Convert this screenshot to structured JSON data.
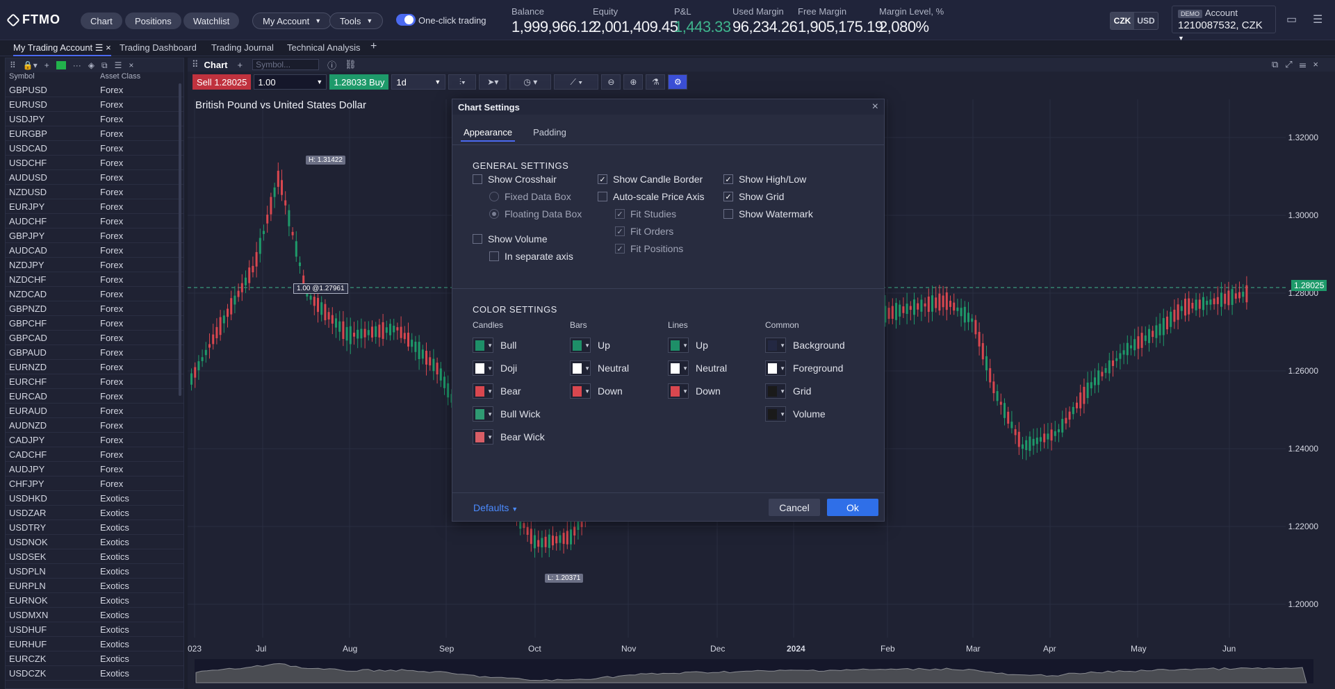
{
  "brand": "FTMO",
  "nav": {
    "chart": "Chart",
    "positions": "Positions",
    "watchlist": "Watchlist",
    "my_account": "My Account",
    "tools": "Tools",
    "one_click": "One-click trading"
  },
  "metrics": {
    "balance_label": "Balance",
    "balance": "1,999,966.12",
    "equity_label": "Equity",
    "equity": "2,001,409.45",
    "pnl_label": "P&L",
    "pnl": "1,443.33",
    "used_margin_label": "Used Margin",
    "used_margin": "96,234.26",
    "free_margin_label": "Free Margin",
    "free_margin": "1,905,175.19",
    "margin_level_label": "Margin Level, %",
    "margin_level": "2,080%"
  },
  "currency": {
    "czk": "CZK",
    "usd": "USD"
  },
  "account": {
    "badge": "DEMO",
    "label": "Account",
    "number": "1210087532, CZK"
  },
  "tabs": {
    "my_trading_account": "My Trading Account",
    "trading_dashboard": "Trading Dashboard",
    "trading_journal": "Trading Journal",
    "technical_analysis": "Technical Analysis"
  },
  "watchlist": {
    "col_symbol": "Symbol",
    "col_class": "Asset Class",
    "rows": [
      [
        "GBPUSD",
        "Forex"
      ],
      [
        "EURUSD",
        "Forex"
      ],
      [
        "USDJPY",
        "Forex"
      ],
      [
        "EURGBP",
        "Forex"
      ],
      [
        "USDCAD",
        "Forex"
      ],
      [
        "USDCHF",
        "Forex"
      ],
      [
        "AUDUSD",
        "Forex"
      ],
      [
        "NZDUSD",
        "Forex"
      ],
      [
        "EURJPY",
        "Forex"
      ],
      [
        "AUDCHF",
        "Forex"
      ],
      [
        "GBPJPY",
        "Forex"
      ],
      [
        "AUDCAD",
        "Forex"
      ],
      [
        "NZDJPY",
        "Forex"
      ],
      [
        "NZDCHF",
        "Forex"
      ],
      [
        "NZDCAD",
        "Forex"
      ],
      [
        "GBPNZD",
        "Forex"
      ],
      [
        "GBPCHF",
        "Forex"
      ],
      [
        "GBPCAD",
        "Forex"
      ],
      [
        "GBPAUD",
        "Forex"
      ],
      [
        "EURNZD",
        "Forex"
      ],
      [
        "EURCHF",
        "Forex"
      ],
      [
        "EURCAD",
        "Forex"
      ],
      [
        "EURAUD",
        "Forex"
      ],
      [
        "AUDNZD",
        "Forex"
      ],
      [
        "CADJPY",
        "Forex"
      ],
      [
        "CADCHF",
        "Forex"
      ],
      [
        "AUDJPY",
        "Forex"
      ],
      [
        "CHFJPY",
        "Forex"
      ],
      [
        "USDHKD",
        "Exotics"
      ],
      [
        "USDZAR",
        "Exotics"
      ],
      [
        "USDTRY",
        "Exotics"
      ],
      [
        "USDNOK",
        "Exotics"
      ],
      [
        "USDSEK",
        "Exotics"
      ],
      [
        "USDPLN",
        "Exotics"
      ],
      [
        "EURPLN",
        "Exotics"
      ],
      [
        "EURNOK",
        "Exotics"
      ],
      [
        "USDMXN",
        "Exotics"
      ],
      [
        "USDHUF",
        "Exotics"
      ],
      [
        "EURHUF",
        "Exotics"
      ],
      [
        "EURCZK",
        "Exotics"
      ],
      [
        "USDCZK",
        "Exotics"
      ]
    ]
  },
  "chart": {
    "tab": "Chart",
    "symbol_placeholder": "Symbol...",
    "sell_label": "Sell",
    "sell_price": "1.28025",
    "quantity": "1.00",
    "buy_label": "Buy",
    "buy_price": "1.28033",
    "timeframe": "1d",
    "title": "British Pound vs United States Dollar",
    "high_tag": "H: 1.31422",
    "low_tag": "L: 1.20371",
    "order_tag": "1.00 @1.27961",
    "current_price": "1.28025",
    "price_axis": [
      "1.32000",
      "1.30000",
      "1.28000",
      "1.26000",
      "1.24000",
      "1.22000",
      "1.20000"
    ],
    "date_axis": [
      "023",
      "Jul",
      "Aug",
      "Sep",
      "Oct",
      "Nov",
      "Dec",
      "2024",
      "Feb",
      "Mar",
      "Apr",
      "May",
      "Jun"
    ]
  },
  "modal": {
    "title": "Chart Settings",
    "tab_appearance": "Appearance",
    "tab_padding": "Padding",
    "general_title": "GENERAL SETTINGS",
    "show_crosshair": "Show Crosshair",
    "fixed_data_box": "Fixed Data Box",
    "floating_data_box": "Floating Data Box",
    "show_volume": "Show Volume",
    "in_separate_axis": "In separate axis",
    "show_candle_border": "Show Candle Border",
    "auto_scale": "Auto-scale Price Axis",
    "fit_studies": "Fit Studies",
    "fit_orders": "Fit Orders",
    "fit_positions": "Fit Positions",
    "show_high_low": "Show High/Low",
    "show_grid": "Show Grid",
    "show_watermark": "Show Watermark",
    "color_title": "COLOR SETTINGS",
    "col_candles": "Candles",
    "col_bars": "Bars",
    "col_lines": "Lines",
    "col_common": "Common",
    "candles": [
      "Bull",
      "Doji",
      "Bear",
      "Bull Wick",
      "Bear Wick"
    ],
    "bars": [
      "Up",
      "Neutral",
      "Down"
    ],
    "lines": [
      "Up",
      "Neutral",
      "Down"
    ],
    "common": [
      "Background",
      "Foreground",
      "Grid",
      "Volume"
    ],
    "defaults": "Defaults",
    "cancel": "Cancel",
    "ok": "Ok"
  },
  "colors": {
    "accent": "#4b6af0",
    "green": "#1e9a6a",
    "red": "#c0323e",
    "swatch_green": "#1e8f68",
    "swatch_white": "#ffffff",
    "swatch_red": "#d9474f",
    "swatch_bullwick": "#2f9a72",
    "swatch_bearwick": "#d85e66",
    "swatch_bg": "#232842",
    "swatch_grid": "#1a1a1a",
    "swatch_volume": "#1a1a1a"
  }
}
